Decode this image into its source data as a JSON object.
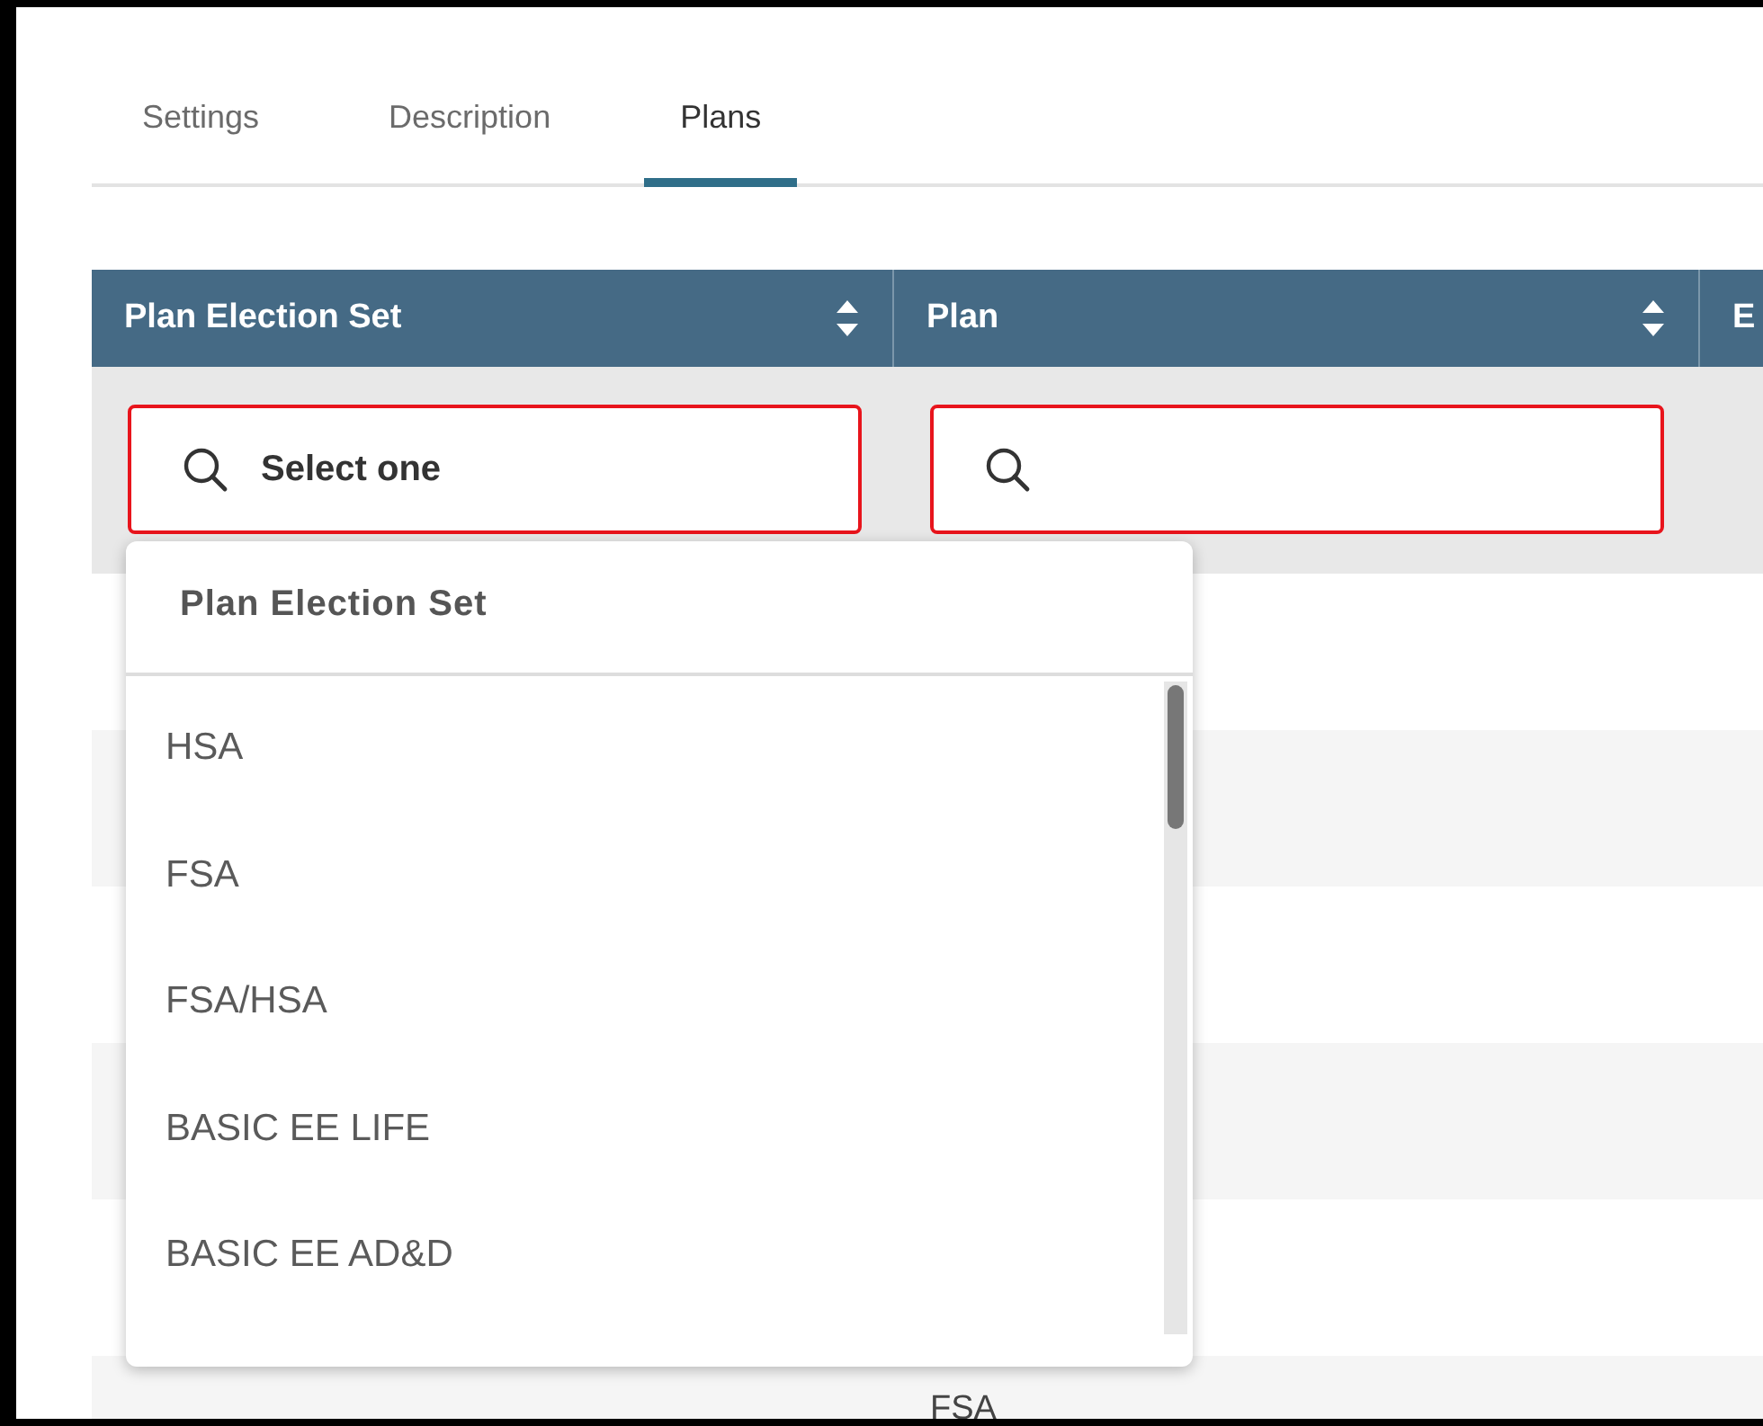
{
  "tabs": [
    {
      "label": "Settings",
      "selected": false
    },
    {
      "label": "Description",
      "selected": false
    },
    {
      "label": "Plans",
      "selected": true
    }
  ],
  "table": {
    "columns": [
      {
        "label": "Plan Election Set",
        "sortable": true
      },
      {
        "label": "Plan",
        "sortable": true
      },
      {
        "label": "E",
        "sortable": false
      }
    ],
    "filters": [
      {
        "value": "Select one",
        "invalid": true
      },
      {
        "invalid": true
      }
    ],
    "rows": [
      {
        "column_2": "FSA"
      }
    ]
  },
  "dropdown": {
    "title": "Plan Election Set",
    "options": [
      "HSA",
      "FSA",
      "FSA/HSA",
      "BASIC EE LIFE",
      "BASIC EE AD&D"
    ]
  }
}
